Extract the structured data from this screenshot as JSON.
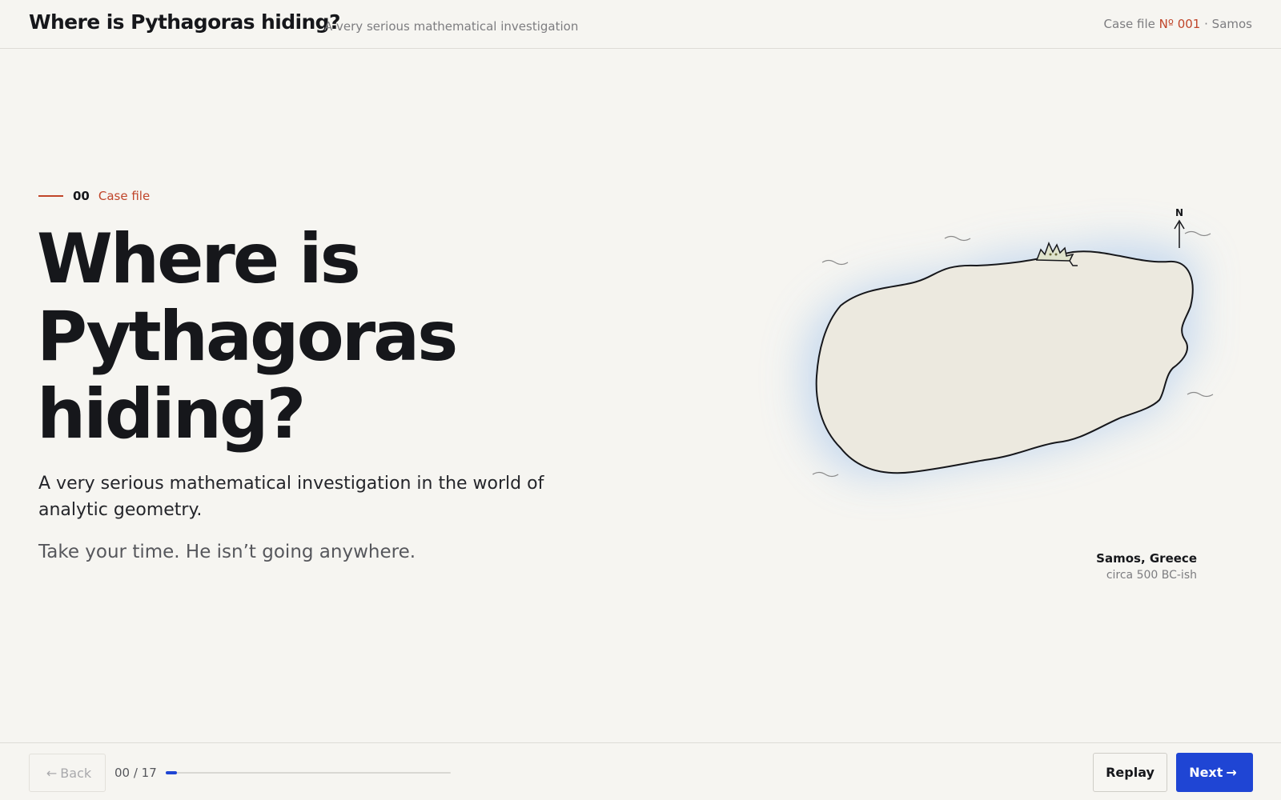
{
  "header": {
    "title": "Where is Pythagoras hiding?",
    "subtitle": "A very serious mathematical investigation",
    "case_prefix": "Case file",
    "case_number": "Nº 001",
    "case_separator": "·",
    "case_location": "Samos"
  },
  "intro": {
    "index": "00",
    "label": "Case file",
    "title": "Where is Pythagoras hiding?",
    "lead": "A very serious mathematical investigation in the world of analytic geometry.",
    "aside": "Take your time. He isn’t going anywhere."
  },
  "map": {
    "compass_label": "N",
    "caption_place": "Samos, Greece",
    "caption_era": "circa 500 BC-ish",
    "icon_names": [
      "compass-arrow-icon",
      "wave-icon",
      "hiding-figure-icon"
    ],
    "colors": {
      "island_fill": "#ece9df",
      "island_stroke": "#16171b",
      "sea_glow": "#bcd3ee"
    }
  },
  "footer": {
    "back_label": "Back",
    "back_icon": "arrow-left-icon",
    "progress_text": "00 / 17",
    "progress_fraction": 0.04,
    "replay_label": "Replay",
    "next_label": "Next",
    "next_icon": "arrow-right-icon"
  },
  "colors": {
    "background": "#f6f5f1",
    "accent": "#c0452a",
    "primary": "#1f45d4",
    "text": "#16171b",
    "muted": "#7d7d80"
  }
}
